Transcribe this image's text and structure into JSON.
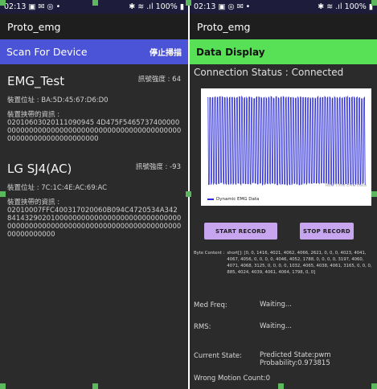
{
  "screen1": {
    "status": {
      "time": "02:13",
      "left_icons": "▣ ✉ ◎ •",
      "right_icons": "✱ ≋ .ıl",
      "battery": "100%"
    },
    "app_title": "Proto_emg",
    "scan": {
      "title": "Scan For Device",
      "stop_label": "停止掃描"
    },
    "devices": [
      {
        "name": "EMG_Test",
        "rssi": "訊號強度 : 64",
        "address": "裝置位址 : BA:5D:45:67:D6:D0",
        "adv_label": "裝置挾帶的資訊 :",
        "adv_data": "02010603020111090945 4D475F54657374000000000000000000000000000000000000000000000000000000000000000000"
      },
      {
        "name": "LG SJ4(AC)",
        "rssi": "訊號強度 : -93",
        "address": "裝置位址 : 7C:1C:4E:AC:69:AC",
        "adv_label": "裝置挾帶的資訊 :",
        "adv_data": "02010007FFC400317020060B094C4720534A3428414329020100000000000000000000000000000000000000000000000000000000000000000000000000000000"
      }
    ]
  },
  "screen2": {
    "status": {
      "time": "02:13",
      "left_icons": "▣ ◎ ✉ •",
      "right_icons": "✱ ≋ .ıl",
      "battery": "100%"
    },
    "app_title": "Proto_emg",
    "header": "Data Display",
    "connection_status": "Connection Status : Connected",
    "chart_data": {
      "type": "line",
      "series": [
        {
          "name": "Dynamic EMG Data",
          "color": "#2b2bd6"
        }
      ],
      "grid": false,
      "legend": "bottom-left",
      "pattern": "dense oscillation between 0 and ~4095"
    },
    "buttons": {
      "start": "START RECORD",
      "stop": "STOP RECORD"
    },
    "byte_content": {
      "label": "Byte Content :",
      "value": "short[]: [0, 0, 1416, 4021, 4062, 4066, 2621, 0, 0, 0, 4023, 4041, 4067, 4056, 0, 0, 0, 0, 4046, 4052, 1788, 0, 0, 0, 0, 3197, 4060, 4071, 4068, 3125, 0, 0, 0, 0, 1032, 4065, 4038, 4061, 3165, 0, 0, 0, 885, 4024, 4039, 4061, 4064, 1798, 0, 0]"
    },
    "med_freq": {
      "label": "Med Freq:",
      "value": "Waiting..."
    },
    "rms": {
      "label": "RMS:",
      "value": "Waiting..."
    },
    "current_state": {
      "label": "Current State:",
      "value_line1": "Predicted State:pwm",
      "value_line2": "Probability:0.973815"
    },
    "wrong_motion": "Wrong Motion Count:0"
  },
  "colors": {
    "scan_bar": "#4b53d6",
    "data_bar": "#58e057",
    "button": "#c8a6ef",
    "series": "#2b2bd6"
  }
}
